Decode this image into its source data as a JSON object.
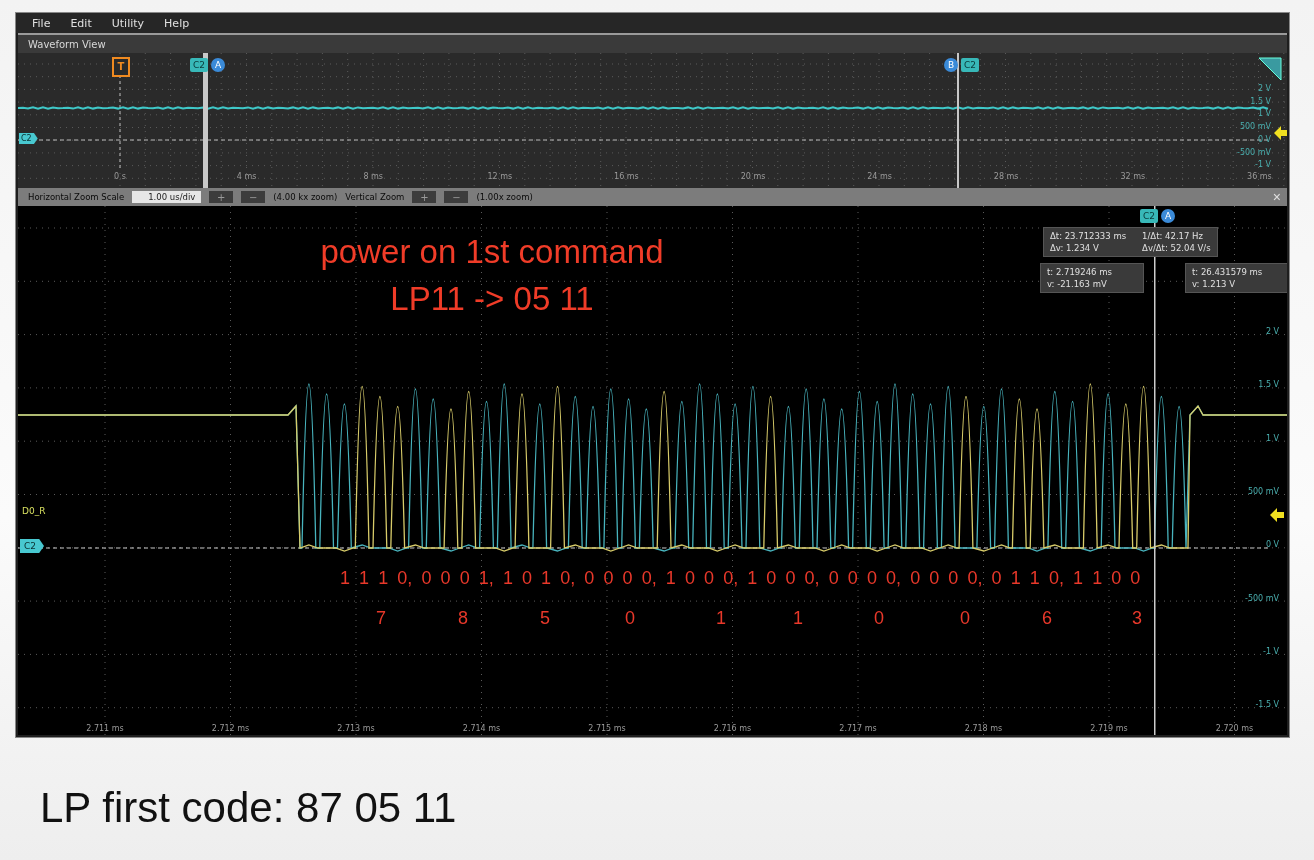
{
  "menu": [
    "File",
    "Edit",
    "Utility",
    "Help"
  ],
  "waveform_view": {
    "title": "Waveform View",
    "overview": {
      "trigger": "T",
      "channel_label": "C2",
      "cursor_a_badges": [
        {
          "kind": "channel",
          "label": "C2"
        },
        {
          "kind": "cursor",
          "label": "A"
        }
      ],
      "cursor_b_badges": [
        {
          "kind": "cursor",
          "label": "B"
        },
        {
          "kind": "channel",
          "label": "C2"
        }
      ],
      "x_ticks": [
        "0 s",
        "4 ms",
        "8 ms",
        "12 ms",
        "16 ms",
        "20 ms",
        "24 ms",
        "28 ms",
        "32 ms",
        "36 ms"
      ],
      "y_ticks": [
        "2 V",
        "1.5 V",
        "1 V",
        "500 mV",
        "0 V",
        "-500 mV",
        "-1 V"
      ]
    },
    "zoom_bar": {
      "h_label": "Horizontal Zoom Scale",
      "h_value": "1.00 us/div",
      "h_zoom_in": "+",
      "h_zoom_out": "−",
      "h_info": "(4.00 kx zoom)",
      "v_label": "Vertical Zoom",
      "v_zoom_in": "+",
      "v_zoom_out": "−",
      "v_info": "(1.00x zoom)",
      "close": "×"
    },
    "zoom_plot": {
      "signal_label": "D0_R",
      "channel_label": "C2",
      "cursor_badges": [
        {
          "kind": "channel",
          "label": "C2"
        },
        {
          "kind": "cursor",
          "label": "A"
        }
      ],
      "readout": {
        "delta": [
          "Δt: 23.712333 ms",
          "1/Δt: 42.17 Hz",
          "Δv: 1.234 V",
          "Δv/Δt: 52.04 V/s"
        ],
        "cursor_a": [
          "t: 2.719246 ms",
          "v: -21.163 mV"
        ],
        "cursor_b": [
          "t: 26.431579 ms",
          "v: 1.213 V"
        ]
      },
      "x_ticks": [
        "2.711 ms",
        "2.712 ms",
        "2.713 ms",
        "2.714 ms",
        "2.715 ms",
        "2.716 ms",
        "2.717 ms",
        "2.718 ms",
        "2.719 ms",
        "2.720 ms"
      ],
      "y_ticks": [
        "2 V",
        "1.5 V",
        "1 V",
        "500 mV",
        "0 V",
        "-500 mV",
        "-1 V",
        "-1.5 V"
      ],
      "annotation_lines": [
        "power on 1st command",
        "LP11 -> 05 11"
      ],
      "bits": "1 1 1 0, 0 0 0 1, 1 0 1 0, 0 0 0 0, 1 0 0 0, 1 0 0 0, 0 0 0 0, 0 0 0 0, 0 1 1 0, 1 1 0 0",
      "digits": [
        "7",
        "8",
        "5",
        "0",
        "1",
        "1",
        "0",
        "0",
        "6",
        "3"
      ]
    }
  },
  "caption": "LP first code: 87 05 11"
}
